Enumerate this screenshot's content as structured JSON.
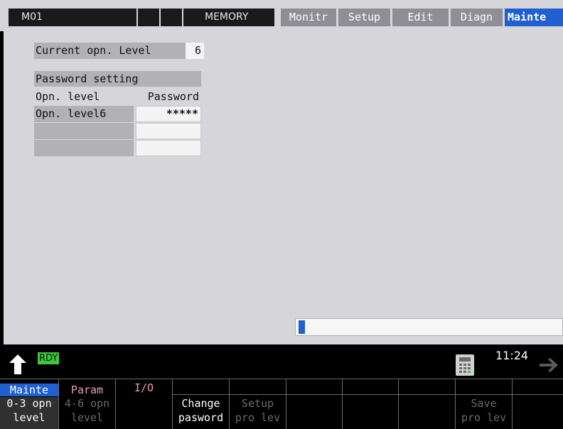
{
  "topbar": {
    "program": "M01",
    "mode": "MEMORY",
    "tabs": [
      {
        "label": "Monitr",
        "active": false
      },
      {
        "label": "Setup",
        "active": false
      },
      {
        "label": "Edit",
        "active": false
      },
      {
        "label": "Diagn",
        "active": false
      },
      {
        "label": "Mainte",
        "active": true
      }
    ]
  },
  "main": {
    "current_level_label": "Current opn. Level",
    "current_level_value": "6",
    "password_setting_title": "Password setting",
    "col_level": "Opn. level",
    "col_password": "Password",
    "rows": [
      {
        "level": "Opn. level6",
        "password": "*****"
      },
      {
        "level": "",
        "password": ""
      },
      {
        "level": "",
        "password": ""
      }
    ]
  },
  "status": {
    "ready": "RDY",
    "time": "11:24"
  },
  "softkeys": {
    "tabs": [
      {
        "label": "Mainte",
        "active": true
      },
      {
        "label": "Param",
        "active": false
      },
      {
        "label": "I/O",
        "active": false
      }
    ],
    "keys": [
      {
        "line1": "0-3 opn",
        "line2": "level",
        "enabled": true
      },
      {
        "line1": "4-6 opn",
        "line2": "level",
        "enabled": false
      },
      {
        "line1": "",
        "line2": "",
        "enabled": false
      },
      {
        "line1": "Change",
        "line2": "pasword",
        "enabled": true
      },
      {
        "line1": "Setup",
        "line2": "pro lev",
        "enabled": false
      },
      {
        "line1": "",
        "line2": "",
        "enabled": false
      },
      {
        "line1": "",
        "line2": "",
        "enabled": false
      },
      {
        "line1": "",
        "line2": "",
        "enabled": false
      },
      {
        "line1": "Save",
        "line2": "pro lev",
        "enabled": false
      },
      {
        "line1": "",
        "line2": "",
        "enabled": false
      }
    ]
  },
  "colors": {
    "accent": "#1f5fd0",
    "ready": "#3cc83c",
    "enabled_text": "#ffffff",
    "disabled_text": "#6a6a6a"
  },
  "icons": [
    "up-arrow-icon",
    "calculator-icon",
    "right-arrow-icon"
  ]
}
